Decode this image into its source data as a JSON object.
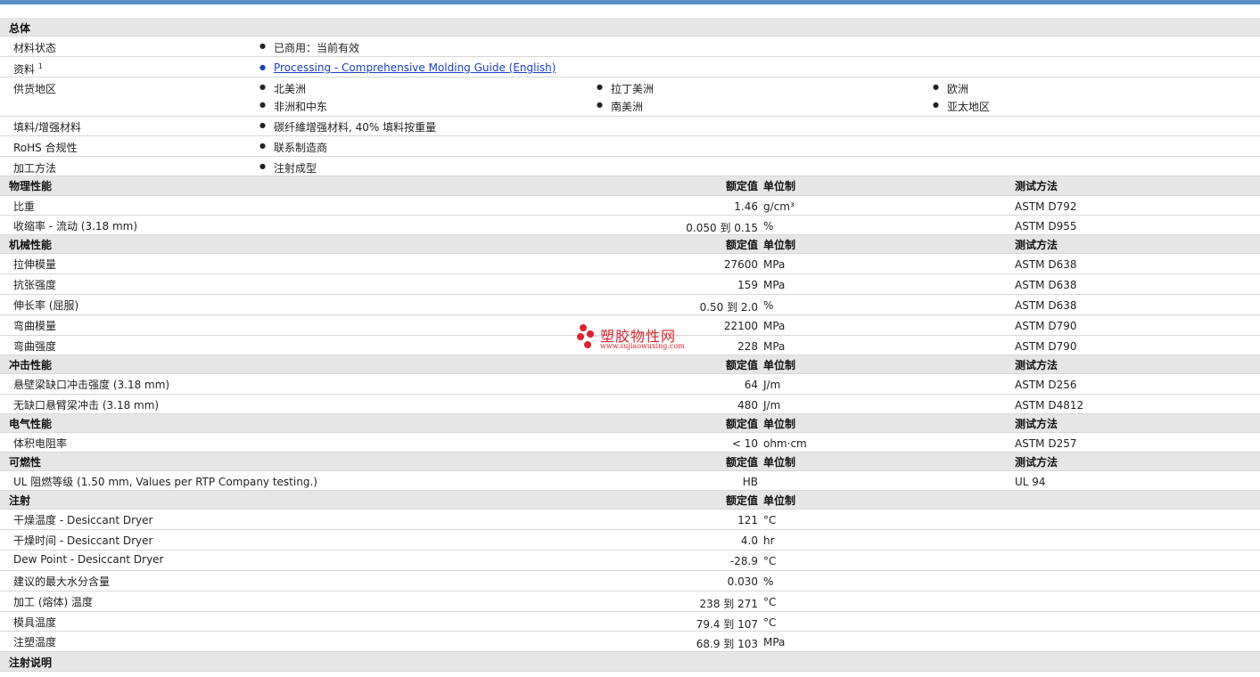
{
  "general": {
    "section_title": "总体",
    "status_label": "材料状态",
    "status_value": "已商用：当前有效",
    "docs_label": "资料",
    "docs_sup": "1",
    "docs_link": "Processing - Comprehensive Molding Guide (English)",
    "supply_label": "供货地区",
    "regions": [
      "北美洲",
      "拉丁美洲",
      "欧洲",
      "非洲和中东",
      "南美洲",
      "亚太地区"
    ],
    "filler_label": "填料/增强材料",
    "filler_value": "碳纤維增强材料, 40% 填料按重量",
    "rohs_label": "RoHS 合规性",
    "rohs_value": "联系制造商",
    "process_label": "加工方法",
    "process_value": "注射成型"
  },
  "columns": {
    "value": "额定值",
    "unit": "单位制",
    "test": "测试方法"
  },
  "sections": [
    {
      "title": "物理性能",
      "has_test": true,
      "rows": [
        {
          "name": "比重",
          "value": "1.46",
          "unit": "g/cm³",
          "test": "ASTM D792"
        },
        {
          "name": "收缩率 - 流动 (3.18 mm)",
          "value": "0.050 到  0.15",
          "unit": "%",
          "test": "ASTM D955"
        }
      ]
    },
    {
      "title": "机械性能",
      "has_test": true,
      "rows": [
        {
          "name": "拉伸模量",
          "value": "27600",
          "unit": "MPa",
          "test": "ASTM D638"
        },
        {
          "name": "抗张强度",
          "value": "159",
          "unit": "MPa",
          "test": "ASTM D638"
        },
        {
          "name": "伸长率 (屈服)",
          "value": "0.50 到  2.0",
          "unit": "%",
          "test": "ASTM D638"
        },
        {
          "name": "弯曲模量",
          "value": "22100",
          "unit": "MPa",
          "test": "ASTM D790"
        },
        {
          "name": "弯曲强度",
          "value": "228",
          "unit": "MPa",
          "test": "ASTM D790"
        }
      ]
    },
    {
      "title": "冲击性能",
      "has_test": true,
      "rows": [
        {
          "name": "悬壁梁缺口冲击强度 (3.18 mm)",
          "value": "64",
          "unit": "J/m",
          "test": "ASTM D256"
        },
        {
          "name": "无缺口悬臂梁冲击 (3.18 mm)",
          "value": "480",
          "unit": "J/m",
          "test": "ASTM D4812"
        }
      ]
    },
    {
      "title": "电气性能",
      "has_test": true,
      "rows": [
        {
          "name": "体积电阻率",
          "value": "< 10",
          "unit": "ohm·cm",
          "test": "ASTM D257"
        }
      ]
    },
    {
      "title": "可燃性",
      "has_test": true,
      "rows": [
        {
          "name": "UL 阻燃等级 (1.50 mm, Values per RTP Company testing.)",
          "value": "HB",
          "unit": "",
          "test": "UL 94"
        }
      ]
    },
    {
      "title": "注射",
      "has_test": false,
      "rows": [
        {
          "name": "干燥温度 - Desiccant Dryer",
          "value": "121",
          "unit": "°C",
          "test": ""
        },
        {
          "name": "干燥时间 - Desiccant Dryer",
          "value": "4.0",
          "unit": "hr",
          "test": ""
        },
        {
          "name": "Dew Point - Desiccant Dryer",
          "value": "-28.9",
          "unit": "°C",
          "test": ""
        },
        {
          "name": "建议的最大水分含量",
          "value": "0.030",
          "unit": "%",
          "test": ""
        },
        {
          "name": "加工 (熔体) 温度",
          "value": "238 到  271",
          "unit": "°C",
          "test": ""
        },
        {
          "name": "模具温度",
          "value": "79.4 到  107",
          "unit": "°C",
          "test": ""
        },
        {
          "name": "注塑温度",
          "value": "68.9 到  103",
          "unit": "MPa",
          "test": ""
        }
      ]
    }
  ],
  "notes_title": "注射说明",
  "watermark": {
    "text": "塑胶物性网",
    "sub": "www.sujiaowuxing.com"
  }
}
